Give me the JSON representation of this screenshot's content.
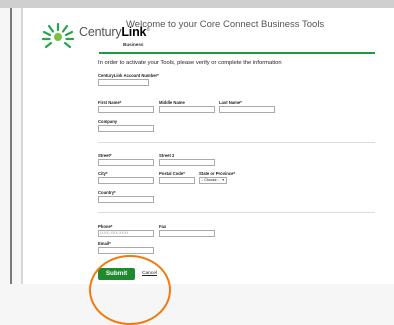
{
  "header": {
    "brand_prefix": "Century",
    "brand_bold": "Link",
    "brand_trademark": "®",
    "brand_sub": "Business",
    "welcome": "Welcome to your Core Connect Business Tools"
  },
  "form": {
    "intro": "In order to activate your Tools, please verify or complete the information",
    "fields": {
      "account_number": {
        "label": "CenturyLink Account Number*",
        "value": ""
      },
      "first_name": {
        "label": "First Name*",
        "value": ""
      },
      "middle_name": {
        "label": "Middle Name",
        "value": ""
      },
      "last_name": {
        "label": "Last Name*",
        "value": ""
      },
      "company": {
        "label": "Company",
        "value": ""
      },
      "street": {
        "label": "Street*",
        "value": ""
      },
      "street2": {
        "label": "Street 2",
        "value": ""
      },
      "city": {
        "label": "City*",
        "value": ""
      },
      "postal_code": {
        "label": "Postal Code*",
        "value": ""
      },
      "state": {
        "label": "State or Province*",
        "selected": "- Choose -"
      },
      "country": {
        "label": "Country*",
        "value": ""
      },
      "phone": {
        "label": "Phone*",
        "placeholder": "(XXX) XXX-XXXX"
      },
      "fax": {
        "label": "Fax",
        "value": ""
      },
      "email": {
        "label": "Email*",
        "value": ""
      }
    },
    "submit_label": "Submit",
    "cancel_label": "Cancel"
  },
  "colors": {
    "brand_green": "#1e8a2e",
    "header_rule": "#1c9a3f",
    "highlight_circle": "#f07a10"
  },
  "icons": {
    "logo": "centurylink-logo-icon",
    "select_arrow": "triangle-down-icon"
  }
}
